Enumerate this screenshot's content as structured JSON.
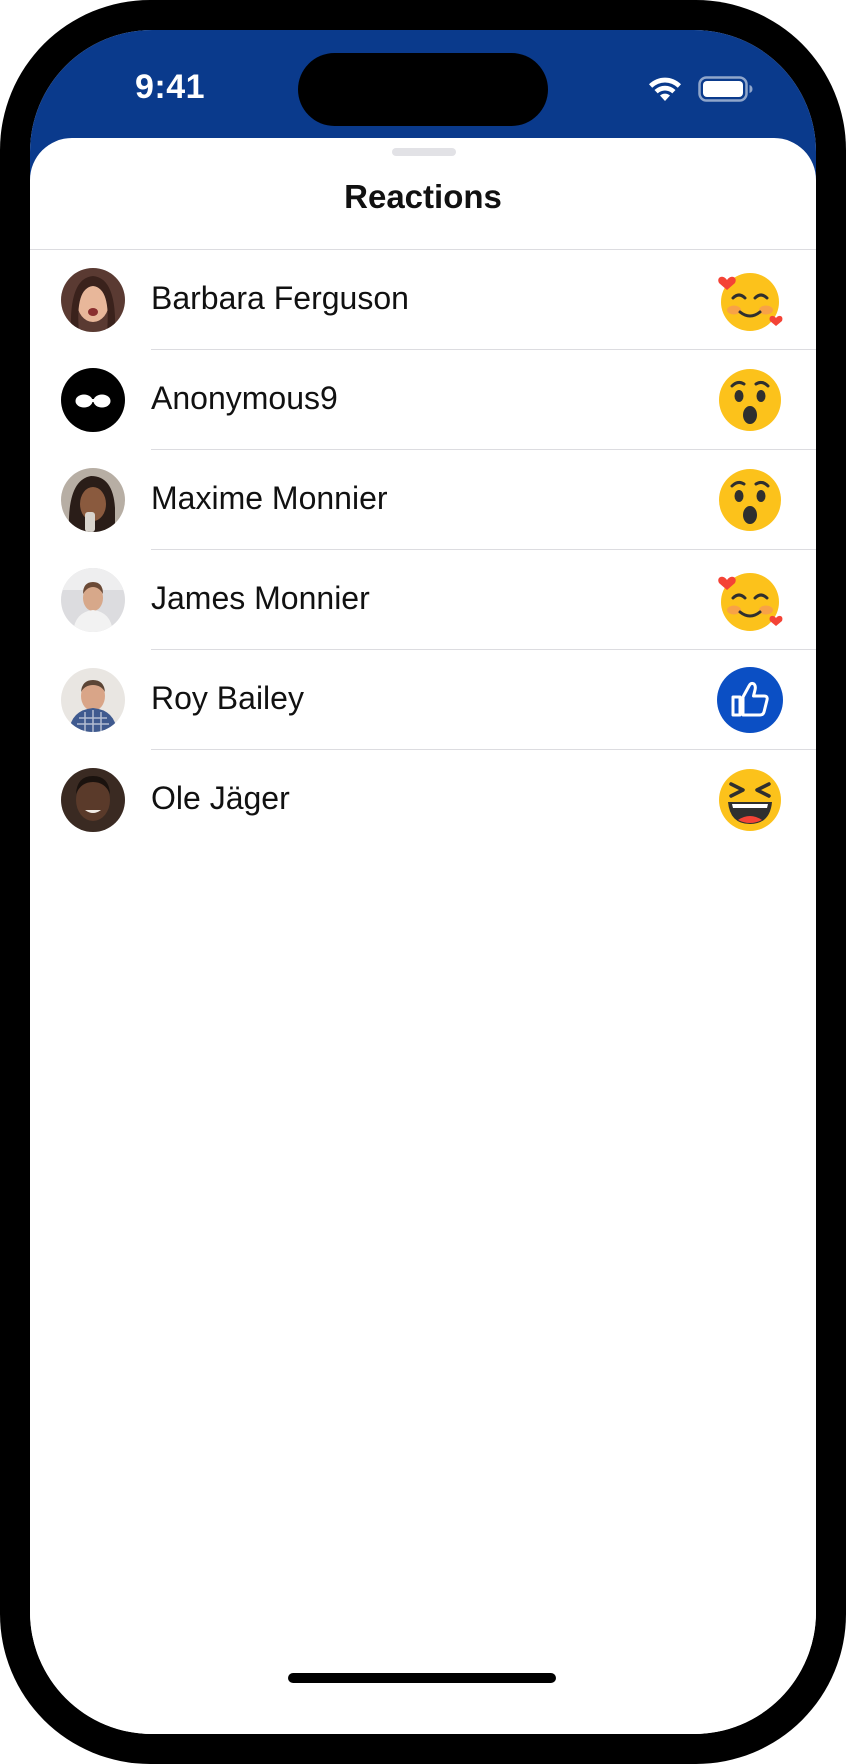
{
  "status_bar": {
    "time": "9:41",
    "background_color": "#0a3a8c",
    "wifi_icon": "wifi-icon",
    "battery_icon": "battery-icon"
  },
  "sheet": {
    "title": "Reactions"
  },
  "reactions": [
    {
      "name": "Barbara Ferguson",
      "avatar": "photo-avatar",
      "reaction": "smiling-face-with-hearts",
      "avatar_color": "#5a3a32"
    },
    {
      "name": "Anonymous9",
      "avatar": "anonymous-avatar",
      "reaction": "astonished-face",
      "avatar_color": "#000000"
    },
    {
      "name": "Maxime Monnier",
      "avatar": "photo-avatar",
      "reaction": "astonished-face",
      "avatar_color": "#6b5a4e"
    },
    {
      "name": "James Monnier",
      "avatar": "photo-avatar",
      "reaction": "smiling-face-with-hearts",
      "avatar_color": "#c9c9cc"
    },
    {
      "name": "Roy Bailey",
      "avatar": "photo-avatar",
      "reaction": "thumbs-up",
      "avatar_color": "#8a6f60"
    },
    {
      "name": "Ole Jäger",
      "avatar": "photo-avatar",
      "reaction": "laughing-face",
      "avatar_color": "#3a2a22"
    }
  ],
  "colors": {
    "like_blue": "#0b4fc4",
    "emoji_yellow": "#fcc21b",
    "heart_red": "#f44336"
  }
}
